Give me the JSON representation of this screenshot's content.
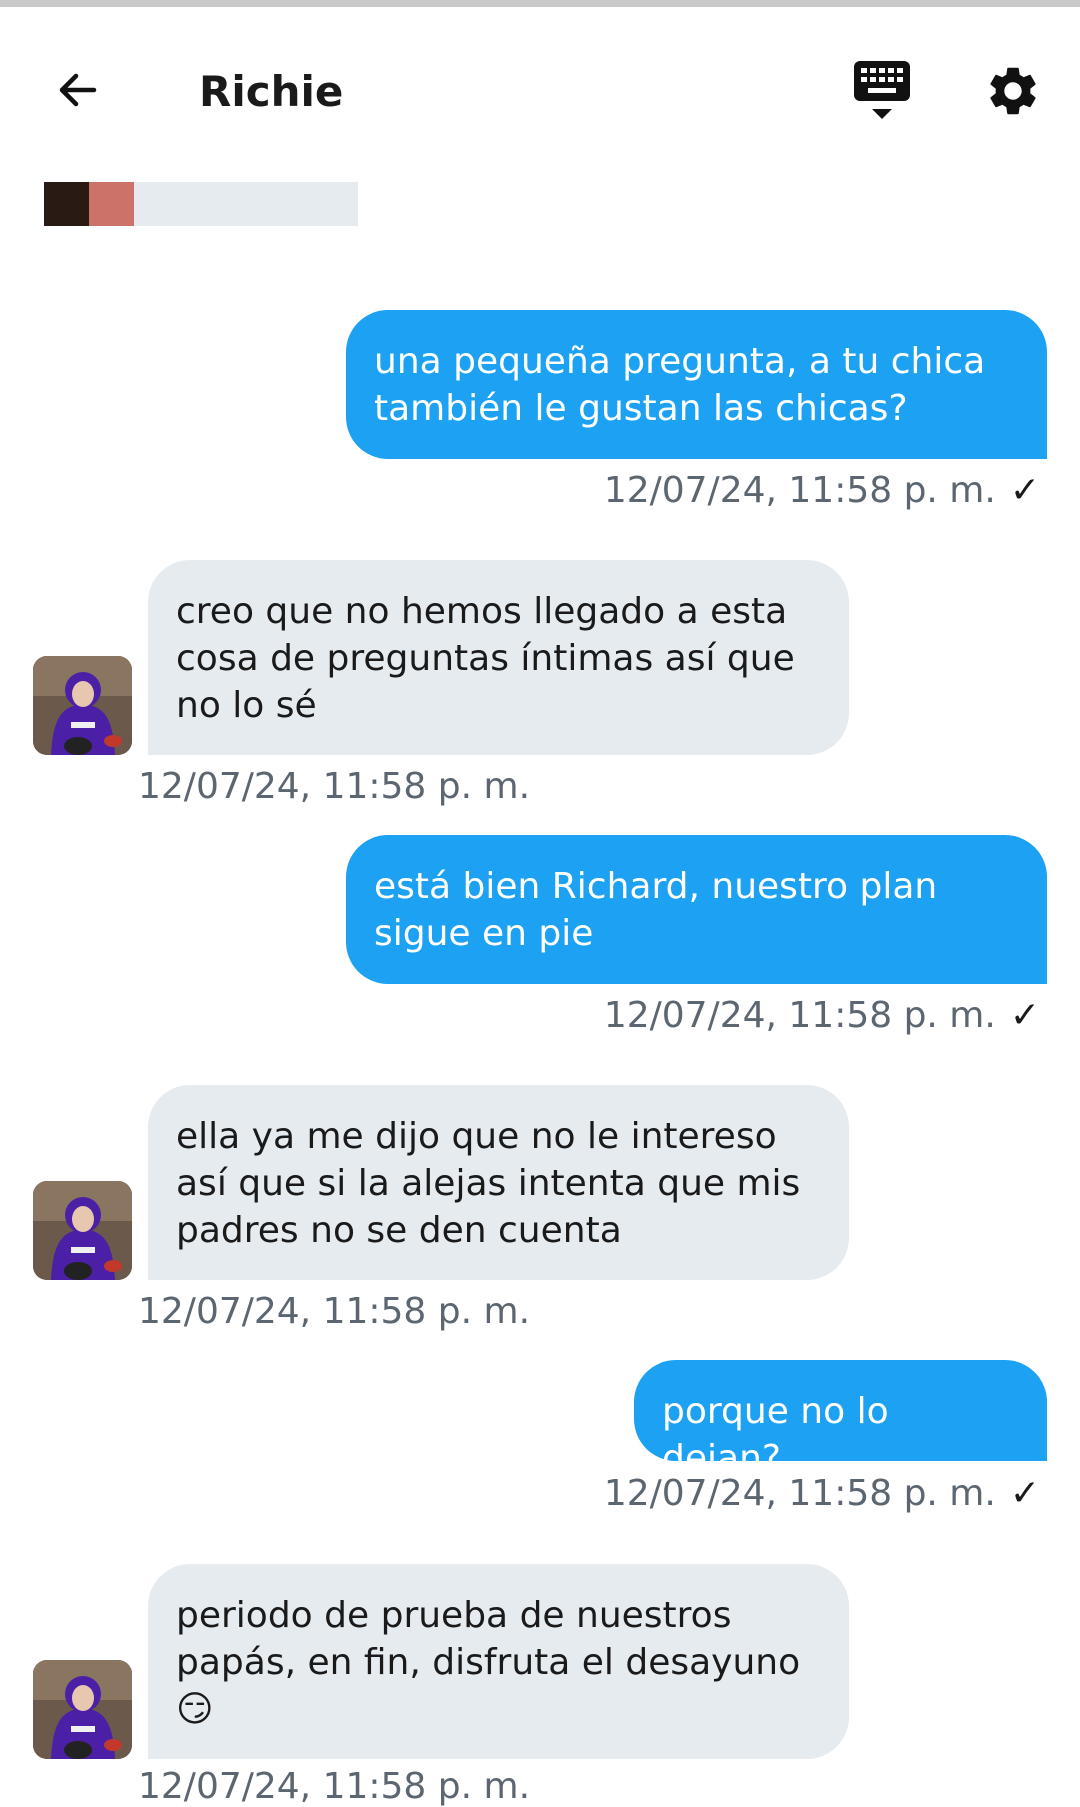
{
  "header": {
    "title": "Richie",
    "back_icon": "arrow-left-icon",
    "keyboard_icon": "keyboard-icon",
    "settings_icon": "gear-icon"
  },
  "colors": {
    "outgoing_bubble": "#1da1f2",
    "incoming_bubble": "#e6ebf0",
    "timestamp": "#5b6670"
  },
  "messages": [
    {
      "direction": "outgoing",
      "text": "una pequeña pregunta, a tu chica también le gustan las chicas?",
      "time": "12/07/24, 11:58 p. m.",
      "status": "✓"
    },
    {
      "direction": "incoming",
      "text": "creo que no hemos llegado a esta cosa de preguntas íntimas así que no lo sé",
      "time": "12/07/24, 11:58 p. m."
    },
    {
      "direction": "outgoing",
      "text": "está bien Richard, nuestro plan sigue en pie",
      "time": "12/07/24, 11:58 p. m.",
      "status": "✓"
    },
    {
      "direction": "incoming",
      "text": "ella ya me dijo que no le intereso así que si la alejas intenta que mis padres no se den cuenta",
      "time": "12/07/24, 11:58 p. m."
    },
    {
      "direction": "outgoing",
      "text": "porque no lo dejan?",
      "time": "12/07/24, 11:58 p. m.",
      "status": "✓"
    },
    {
      "direction": "incoming",
      "text": "periodo de prueba de nuestros papás, en fin, disfruta el desayuno 😏",
      "time": "12/07/24, 11:58 p. m."
    }
  ]
}
